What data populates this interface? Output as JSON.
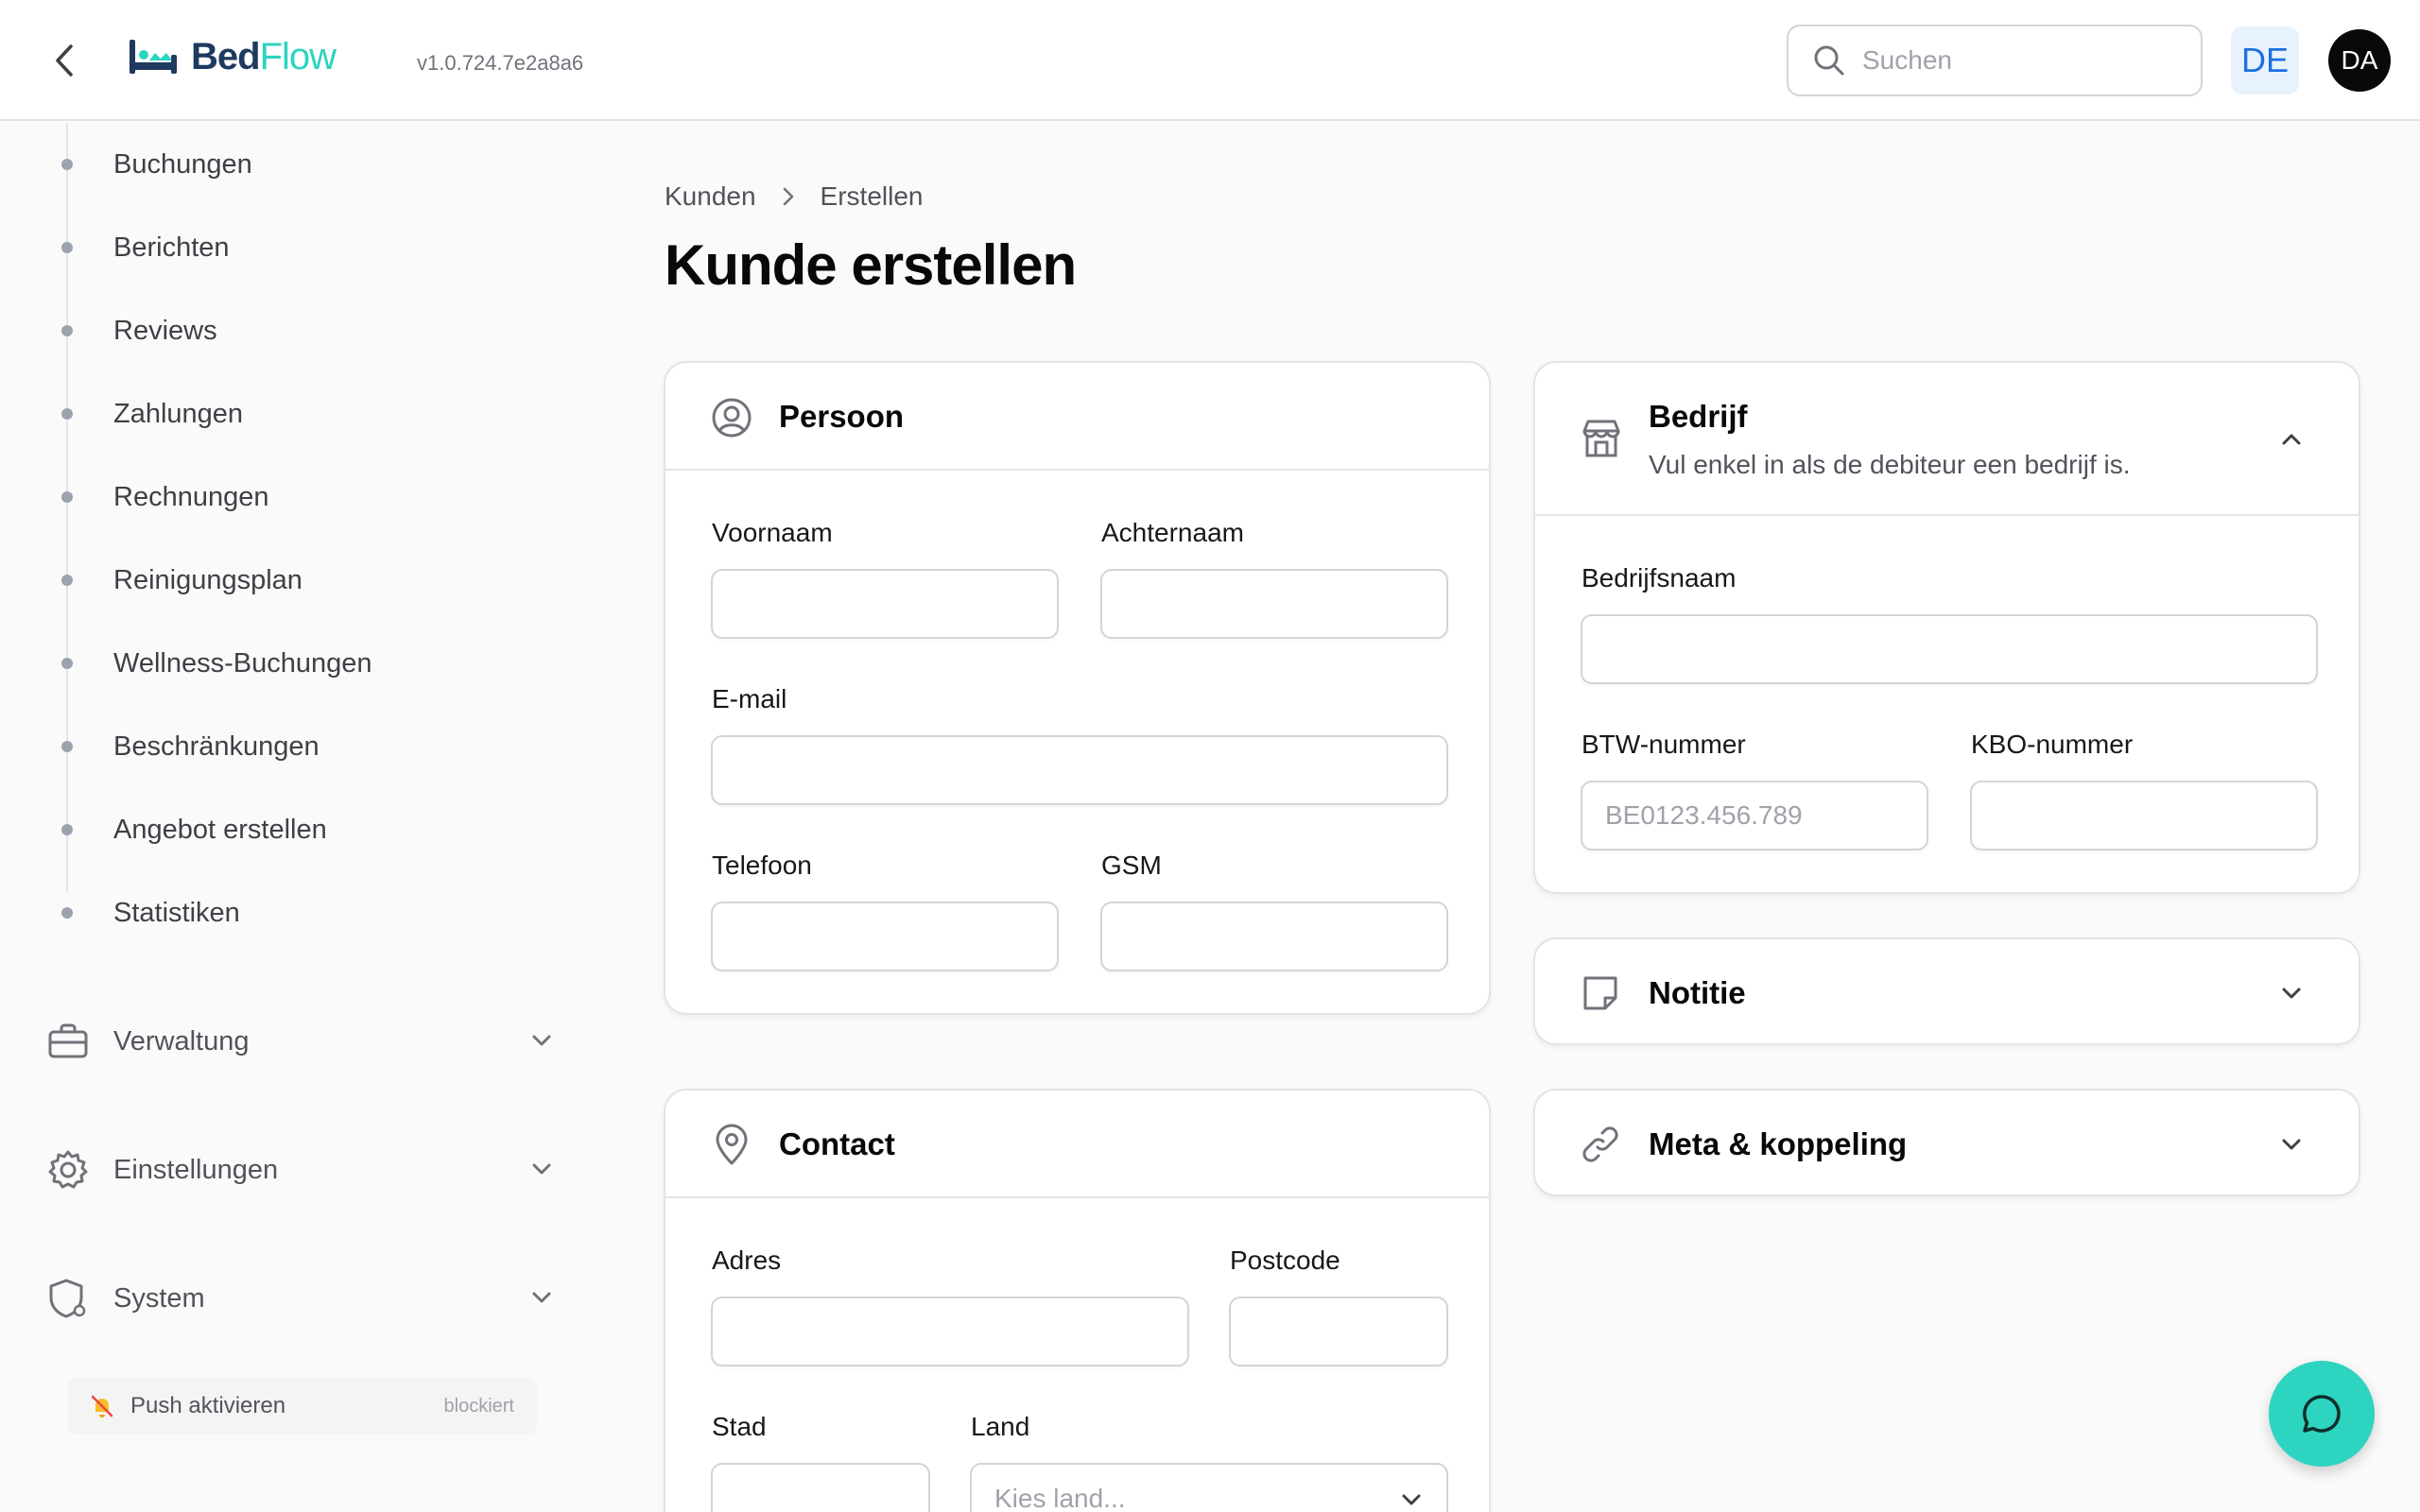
{
  "header": {
    "logo_part1": "Bed",
    "logo_part2": "Flow",
    "version": "v1.0.724.7e2a8a6",
    "search_placeholder": "Suchen",
    "language": "DE",
    "avatar_initials": "DA"
  },
  "sidebar": {
    "items": [
      {
        "label": "Buchungen"
      },
      {
        "label": "Berichten"
      },
      {
        "label": "Reviews"
      },
      {
        "label": "Zahlungen"
      },
      {
        "label": "Rechnungen"
      },
      {
        "label": "Reinigungsplan"
      },
      {
        "label": "Wellness-Buchungen"
      },
      {
        "label": "Beschränkungen"
      },
      {
        "label": "Angebot erstellen"
      },
      {
        "label": "Statistiken"
      }
    ],
    "groups": [
      {
        "label": "Verwaltung",
        "icon": "briefcase-icon"
      },
      {
        "label": "Einstellungen",
        "icon": "gear-icon"
      },
      {
        "label": "System",
        "icon": "shield-icon"
      }
    ],
    "push": {
      "label": "Push aktivieren",
      "status": "blockiert"
    }
  },
  "breadcrumb": {
    "parent": "Kunden",
    "current": "Erstellen"
  },
  "page_title": "Kunde erstellen",
  "persoon": {
    "title": "Persoon",
    "first_name_label": "Voornaam",
    "last_name_label": "Achternaam",
    "email_label": "E-mail",
    "phone_label": "Telefoon",
    "mobile_label": "GSM"
  },
  "contact": {
    "title": "Contact",
    "address_label": "Adres",
    "postcode_label": "Postcode",
    "city_label": "Stad",
    "country_label": "Land",
    "country_placeholder": "Kies land..."
  },
  "bedrijf": {
    "title": "Bedrijf",
    "subtitle": "Vul enkel in als de debiteur een bedrijf is.",
    "company_name_label": "Bedrijfsnaam",
    "vat_label": "BTW-nummer",
    "vat_placeholder": "BE0123.456.789",
    "kbo_label": "KBO-nummer"
  },
  "notitie": {
    "title": "Notitie"
  },
  "meta": {
    "title": "Meta & koppeling"
  },
  "colors": {
    "accent": "#2dd4bf",
    "brand_dark": "#1e3a5f",
    "lang_bg": "#e8f2fd",
    "lang_fg": "#1d6fe0"
  }
}
